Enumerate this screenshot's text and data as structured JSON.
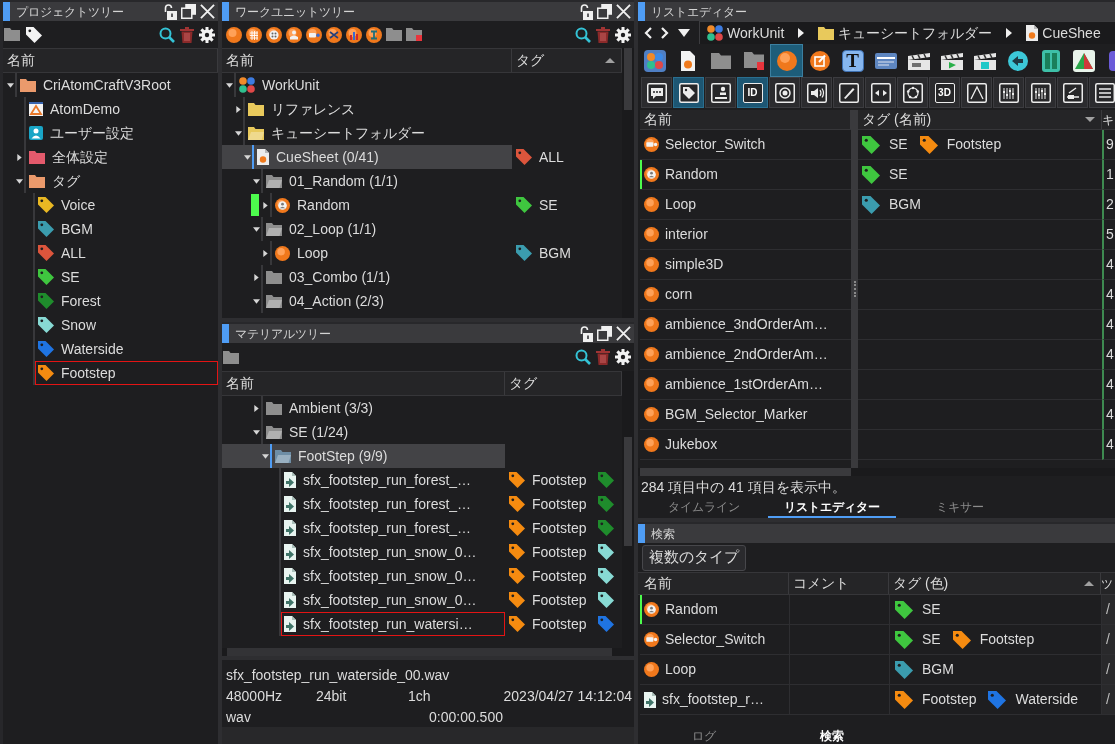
{
  "project_tree": {
    "title": "プロジェクトツリー",
    "columns": [
      {
        "label": "名前"
      }
    ],
    "nodes": [
      {
        "label": "CriAtomCraftV3Root",
        "kind": "root",
        "expanded": true,
        "focused": false,
        "children": [
          {
            "label": "AtomDemo",
            "kind": "project",
            "focused": false
          },
          {
            "label": "ユーザー設定",
            "kind": "user",
            "focused": false
          },
          {
            "label": "全体設定",
            "kind": "settings",
            "expanded": false,
            "focused": false
          },
          {
            "label": "タグ",
            "kind": "root",
            "expanded": true,
            "focused": false,
            "children": [
              {
                "label": "Voice",
                "kind": "tag",
                "color": "#e9b823",
                "focused": false
              },
              {
                "label": "BGM",
                "kind": "tag",
                "color": "#3b9cae",
                "focused": false
              },
              {
                "label": "ALL",
                "kind": "tag",
                "color": "#dc553c",
                "focused": false
              },
              {
                "label": "SE",
                "kind": "tag",
                "color": "#3fc63f",
                "focused": false
              },
              {
                "label": "Forest",
                "kind": "tag",
                "color": "#1f8c2c",
                "focused": false
              },
              {
                "label": "Snow",
                "kind": "tag",
                "color": "#88dad4",
                "focused": false
              },
              {
                "label": "Waterside",
                "kind": "tag",
                "color": "#1f74e2",
                "focused": false
              },
              {
                "label": "Footstep",
                "kind": "tag",
                "color": "#f58b10",
                "focused": true
              }
            ]
          }
        ]
      }
    ]
  },
  "workunit_tree": {
    "title": "ワークユニットツリー",
    "columns": [
      {
        "label": "名前"
      },
      {
        "label": "タグ",
        "sort_ascending": true
      }
    ],
    "nodes": [
      {
        "label": "WorkUnit",
        "kind": "workunit",
        "expanded": true,
        "selected": false,
        "children": [
          {
            "label": "リファレンス",
            "kind": "work_folder",
            "expanded": false,
            "selected": false
          },
          {
            "label": "キューシートフォルダー",
            "kind": "work_folder",
            "expanded": true,
            "selected": false,
            "children": [
              {
                "label": "CueSheet (0/41)",
                "kind": "cuesheet",
                "expanded": true,
                "selected": true,
                "tags": [
                  {
                    "label": "ALL",
                    "color": "#dc553c"
                  }
                ],
                "children": [
                  {
                    "label": "01_Random (1/1)",
                    "kind": "folder",
                    "expanded": true,
                    "selected": false,
                    "children": [
                      {
                        "label": "Random",
                        "kind": "random_cue",
                        "expanded": false,
                        "selected": false,
                        "marked": true,
                        "tags": [
                          {
                            "label": "SE",
                            "color": "#3fc63f"
                          }
                        ]
                      }
                    ]
                  },
                  {
                    "label": "02_Loop (1/1)",
                    "kind": "folder",
                    "expanded": true,
                    "selected": false,
                    "children": [
                      {
                        "label": "Loop",
                        "kind": "cue",
                        "expanded": false,
                        "selected": false,
                        "marked": false,
                        "tags": [
                          {
                            "label": "BGM",
                            "color": "#3b9cae"
                          }
                        ]
                      }
                    ]
                  },
                  {
                    "label": "03_Combo (1/1)",
                    "kind": "folder",
                    "expanded": false,
                    "selected": false
                  },
                  {
                    "label": "04_Action (2/3)",
                    "kind": "folder",
                    "expanded": true,
                    "selected": false
                  }
                ]
              }
            ]
          }
        ]
      }
    ]
  },
  "material_tree": {
    "title": "マテリアルツリー",
    "columns": [
      {
        "label": "名前"
      },
      {
        "label": "タグ"
      }
    ],
    "nodes": [
      {
        "label": "Ambient (3/3)",
        "kind": "folder",
        "expanded": false,
        "selected": false
      },
      {
        "label": "SE (1/24)",
        "kind": "folder",
        "expanded": true,
        "selected": false,
        "children": [
          {
            "label": "FootStep (9/9)",
            "kind": "folder",
            "expanded": true,
            "selected": true,
            "children": [
              {
                "label": "sfx_footstep_run_forest_…",
                "kind": "wave",
                "focused": false,
                "tags": [
                  {
                    "label": "Footstep",
                    "color": "#f58b10"
                  },
                  {
                    "color": "#1f8c2c"
                  }
                ]
              },
              {
                "label": "sfx_footstep_run_forest_…",
                "kind": "wave",
                "focused": false,
                "tags": [
                  {
                    "label": "Footstep",
                    "color": "#f58b10"
                  },
                  {
                    "color": "#1f8c2c"
                  }
                ]
              },
              {
                "label": "sfx_footstep_run_forest_…",
                "kind": "wave",
                "focused": false,
                "tags": [
                  {
                    "label": "Footstep",
                    "color": "#f58b10"
                  },
                  {
                    "color": "#1f8c2c"
                  }
                ]
              },
              {
                "label": "sfx_footstep_run_snow_0…",
                "kind": "wave",
                "focused": false,
                "tags": [
                  {
                    "label": "Footstep",
                    "color": "#f58b10"
                  },
                  {
                    "color": "#88dad4"
                  }
                ]
              },
              {
                "label": "sfx_footstep_run_snow_0…",
                "kind": "wave",
                "focused": false,
                "tags": [
                  {
                    "label": "Footstep",
                    "color": "#f58b10"
                  },
                  {
                    "color": "#88dad4"
                  }
                ]
              },
              {
                "label": "sfx_footstep_run_snow_0…",
                "kind": "wave",
                "focused": false,
                "tags": [
                  {
                    "label": "Footstep",
                    "color": "#f58b10"
                  },
                  {
                    "color": "#88dad4"
                  }
                ]
              },
              {
                "label": "sfx_footstep_run_watersi…",
                "kind": "wave",
                "focused": true,
                "tags": [
                  {
                    "label": "Footstep",
                    "color": "#f58b10"
                  },
                  {
                    "color": "#1f74e2"
                  }
                ]
              }
            ]
          }
        ]
      }
    ],
    "info": {
      "file": "sfx_footstep_run_waterside_00.wav",
      "sample_rate": "48000Hz",
      "bit_depth": "24bit",
      "channels": "1ch",
      "date": "2023/04/27 14:12:04",
      "format": "wav",
      "duration": "0:00:00.500"
    }
  },
  "list_editor": {
    "title": "リストエディター",
    "breadcrumb": [
      {
        "label": "WorkUnit",
        "kind": "workunit"
      },
      {
        "label": "キューシートフォルダー",
        "kind": "work_folder"
      },
      {
        "label": "CueShee",
        "kind": "cuesheet"
      }
    ],
    "type_buttons": [
      {
        "kind": "icon",
        "selected": false
      },
      {
        "kind": "icon",
        "selected": false
      },
      {
        "kind": "icon",
        "selected": false
      },
      {
        "kind": "icon",
        "selected": false
      },
      {
        "kind": "icon",
        "selected": true
      },
      {
        "kind": "icon",
        "selected": false
      },
      {
        "kind": "text",
        "text": "T",
        "selected": false
      },
      {
        "kind": "icon",
        "selected": false
      },
      {
        "kind": "icon",
        "selected": false
      },
      {
        "kind": "icon",
        "selected": false
      },
      {
        "kind": "icon",
        "selected": false
      },
      {
        "kind": "icon",
        "selected": false
      },
      {
        "kind": "icon",
        "selected": false
      },
      {
        "kind": "icon",
        "selected": false
      },
      {
        "kind": "icon",
        "selected": false
      }
    ],
    "view_buttons": [
      {
        "kind": "icon",
        "selected": false
      },
      {
        "kind": "icon",
        "selected": true
      },
      {
        "kind": "icon",
        "selected": false
      },
      {
        "kind": "text",
        "text": "ID",
        "selected": true
      },
      {
        "kind": "icon",
        "selected": false
      },
      {
        "kind": "icon",
        "selected": false
      },
      {
        "kind": "icon",
        "selected": false
      },
      {
        "kind": "icon",
        "selected": false
      },
      {
        "kind": "icon",
        "selected": false
      },
      {
        "kind": "text",
        "text": "3D",
        "selected": false
      },
      {
        "kind": "icon",
        "selected": false
      },
      {
        "kind": "icon",
        "selected": false
      },
      {
        "kind": "icon",
        "selected": false
      },
      {
        "kind": "icon",
        "selected": false
      },
      {
        "kind": "icon",
        "selected": false
      }
    ],
    "columns": [
      {
        "label": "名前"
      },
      {
        "label": "タグ (名前)",
        "sort_ascending": false
      },
      {
        "label": "キ"
      }
    ],
    "rows": [
      {
        "name": "Selector_Switch",
        "kind": "selector_cue",
        "marked": false,
        "tags": [
          {
            "label": "SE",
            "color": "#3fc63f"
          },
          {
            "label": "Footstep",
            "color": "#f58b10"
          }
        ],
        "column_3": "9"
      },
      {
        "name": "Random",
        "kind": "random_cue",
        "marked": true,
        "tags": [
          {
            "label": "SE",
            "color": "#3fc63f"
          }
        ],
        "column_3": "1"
      },
      {
        "name": "Loop",
        "kind": "cue",
        "marked": false,
        "tags": [
          {
            "label": "BGM",
            "color": "#3b9cae"
          }
        ],
        "column_3": "2"
      },
      {
        "name": "interior",
        "kind": "cue",
        "marked": false,
        "column_3": "5"
      },
      {
        "name": "simple3D",
        "kind": "cue",
        "marked": false,
        "column_3": "4"
      },
      {
        "name": "corn",
        "kind": "cue",
        "marked": false,
        "column_3": "4"
      },
      {
        "name": "ambience_3ndOrderAm…",
        "kind": "cue",
        "marked": false,
        "column_3": "4"
      },
      {
        "name": "ambience_2ndOrderAm…",
        "kind": "cue",
        "marked": false,
        "column_3": "4"
      },
      {
        "name": "ambience_1stOrderAm…",
        "kind": "cue",
        "marked": false,
        "column_3": "4"
      },
      {
        "name": "BGM_Selector_Marker",
        "kind": "cue",
        "marked": false,
        "column_3": "4"
      },
      {
        "name": "Jukebox",
        "kind": "cue",
        "marked": false,
        "column_3": "4"
      }
    ],
    "status": "284 項目中の 41 項目を表示中。",
    "tabs": [
      {
        "label": "タイムライン",
        "selected": false
      },
      {
        "label": "リストエディター",
        "selected": true
      },
      {
        "label": "ミキサー",
        "selected": false
      }
    ]
  },
  "search": {
    "title": "検索",
    "type_button": "複数のタイプ",
    "columns": [
      {
        "label": "名前"
      },
      {
        "label": "コメント"
      },
      {
        "label": "タグ (色)",
        "sort_ascending": true
      },
      {
        "label": "ツ"
      }
    ],
    "rows": [
      {
        "name": "Random",
        "kind": "random_cue",
        "marked": true,
        "tags": [
          {
            "label": "SE",
            "color": "#3fc63f"
          }
        ],
        "column_4": "/"
      },
      {
        "name": "Selector_Switch",
        "kind": "selector_cue",
        "marked": false,
        "tags": [
          {
            "label": "SE",
            "color": "#3fc63f"
          },
          {
            "label": "Footstep",
            "color": "#f58b10"
          }
        ],
        "column_4": "/"
      },
      {
        "name": "Loop",
        "kind": "cue",
        "marked": false,
        "tags": [
          {
            "label": "BGM",
            "color": "#3b9cae"
          }
        ],
        "column_4": "/"
      },
      {
        "name": "sfx_footstep_r…",
        "kind": "wave",
        "marked": false,
        "tags": [
          {
            "label": "Footstep",
            "color": "#f58b10"
          },
          {
            "label": "Waterside",
            "color": "#1f74e2"
          }
        ],
        "column_4": "/"
      }
    ],
    "tabs": [
      {
        "label": "ログ",
        "selected": false
      },
      {
        "label": "検索",
        "selected": true
      }
    ]
  }
}
